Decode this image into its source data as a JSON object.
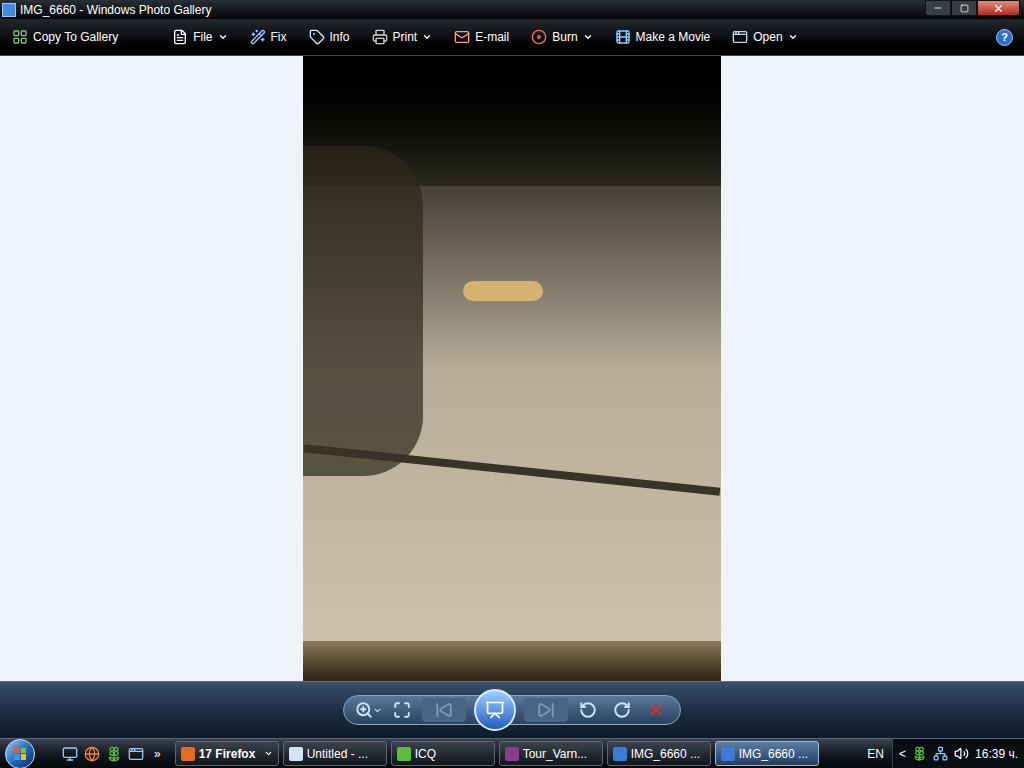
{
  "window": {
    "title": "IMG_6660 - Windows Photo Gallery"
  },
  "toolbar": {
    "items": [
      {
        "label": "Copy To Gallery",
        "dropdown": false,
        "kind": "gallery"
      },
      {
        "label": "File",
        "dropdown": true,
        "kind": "file"
      },
      {
        "label": "Fix",
        "dropdown": false,
        "kind": "fix"
      },
      {
        "label": "Info",
        "dropdown": false,
        "kind": "info"
      },
      {
        "label": "Print",
        "dropdown": true,
        "kind": "print"
      },
      {
        "label": "E-mail",
        "dropdown": false,
        "kind": "email"
      },
      {
        "label": "Burn",
        "dropdown": true,
        "kind": "burn"
      },
      {
        "label": "Make a Movie",
        "dropdown": false,
        "kind": "movie"
      },
      {
        "label": "Open",
        "dropdown": true,
        "kind": "open"
      }
    ],
    "help": "?"
  },
  "controls": [
    {
      "kind": "zoom",
      "disabled": false
    },
    {
      "kind": "fit",
      "disabled": false
    },
    {
      "kind": "previous",
      "disabled": true
    },
    {
      "kind": "slideshow",
      "disabled": false
    },
    {
      "kind": "next",
      "disabled": true
    },
    {
      "kind": "rotate-left",
      "disabled": false
    },
    {
      "kind": "rotate-right",
      "disabled": false
    },
    {
      "kind": "delete",
      "disabled": false
    }
  ],
  "taskbar": {
    "quick_launch_more": "»",
    "items": [
      {
        "label": "17 Firefox",
        "selected": false,
        "dropdown": true,
        "kind": "firefox"
      },
      {
        "label": "Untitled - ...",
        "selected": false,
        "dropdown": false,
        "kind": "notepad"
      },
      {
        "label": "ICQ",
        "selected": false,
        "dropdown": false,
        "kind": "icq"
      },
      {
        "label": "Tour_Varn...",
        "selected": false,
        "dropdown": false,
        "kind": "winrar"
      },
      {
        "label": "IMG_6660 ...",
        "selected": false,
        "dropdown": false,
        "kind": "gallery"
      },
      {
        "label": "IMG_6660 ...",
        "selected": true,
        "dropdown": false,
        "kind": "gallery"
      }
    ],
    "language": "EN",
    "tray_toggle": "<",
    "clock": "16:39 ч."
  }
}
